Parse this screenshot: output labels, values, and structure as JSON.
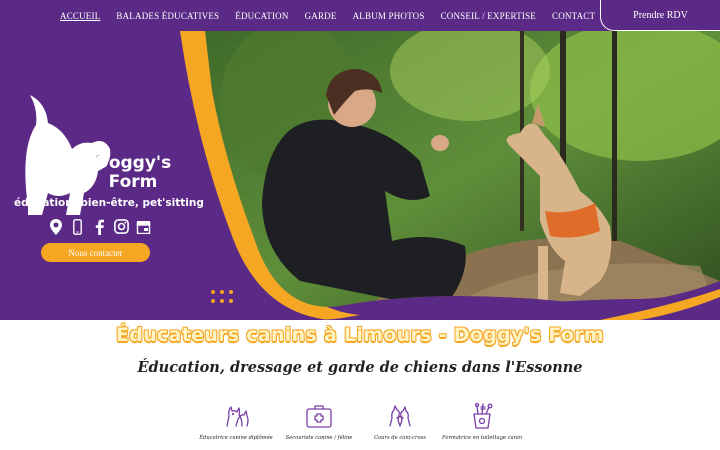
{
  "nav": {
    "items": [
      {
        "label": "ACCUEIL",
        "active": true
      },
      {
        "label": "BALADES ÉDUCATIVES",
        "active": false
      },
      {
        "label": "ÉDUCATION",
        "active": false
      },
      {
        "label": "GARDE",
        "active": false
      },
      {
        "label": "ALBUM PHOTOS",
        "active": false
      },
      {
        "label": "CONSEIL / EXPERTISE",
        "active": false
      },
      {
        "label": "CONTACT",
        "active": false
      }
    ],
    "cta_label": "Prendre RDV"
  },
  "hero": {
    "brand_name": "Doggy's Form",
    "tagline": "éducation, bien-être, pet'sitting",
    "socials": [
      "location-pin-icon",
      "phone-icon",
      "facebook-icon",
      "instagram-icon",
      "store-icon"
    ],
    "contact_label": "Nous contacter"
  },
  "headings": {
    "title": "Éducateurs canins à Limours - Doggy's Form",
    "subtitle": "Éducation, dressage et garde de chiens dans l'Essonne"
  },
  "services": [
    {
      "icon": "cat-dog-icon",
      "label": "Éducatrice canine diplômée"
    },
    {
      "icon": "first-aid-kit-icon",
      "label": "Secouriste canine / féline"
    },
    {
      "icon": "dogs-playing-icon",
      "label": "Cours de cani-cross"
    },
    {
      "icon": "grooming-tools-icon",
      "label": "Formatrice en toilettage canin"
    }
  ],
  "colors": {
    "brand_purple": "#5b2a86",
    "accent_orange": "#f5a623",
    "white": "#ffffff"
  }
}
